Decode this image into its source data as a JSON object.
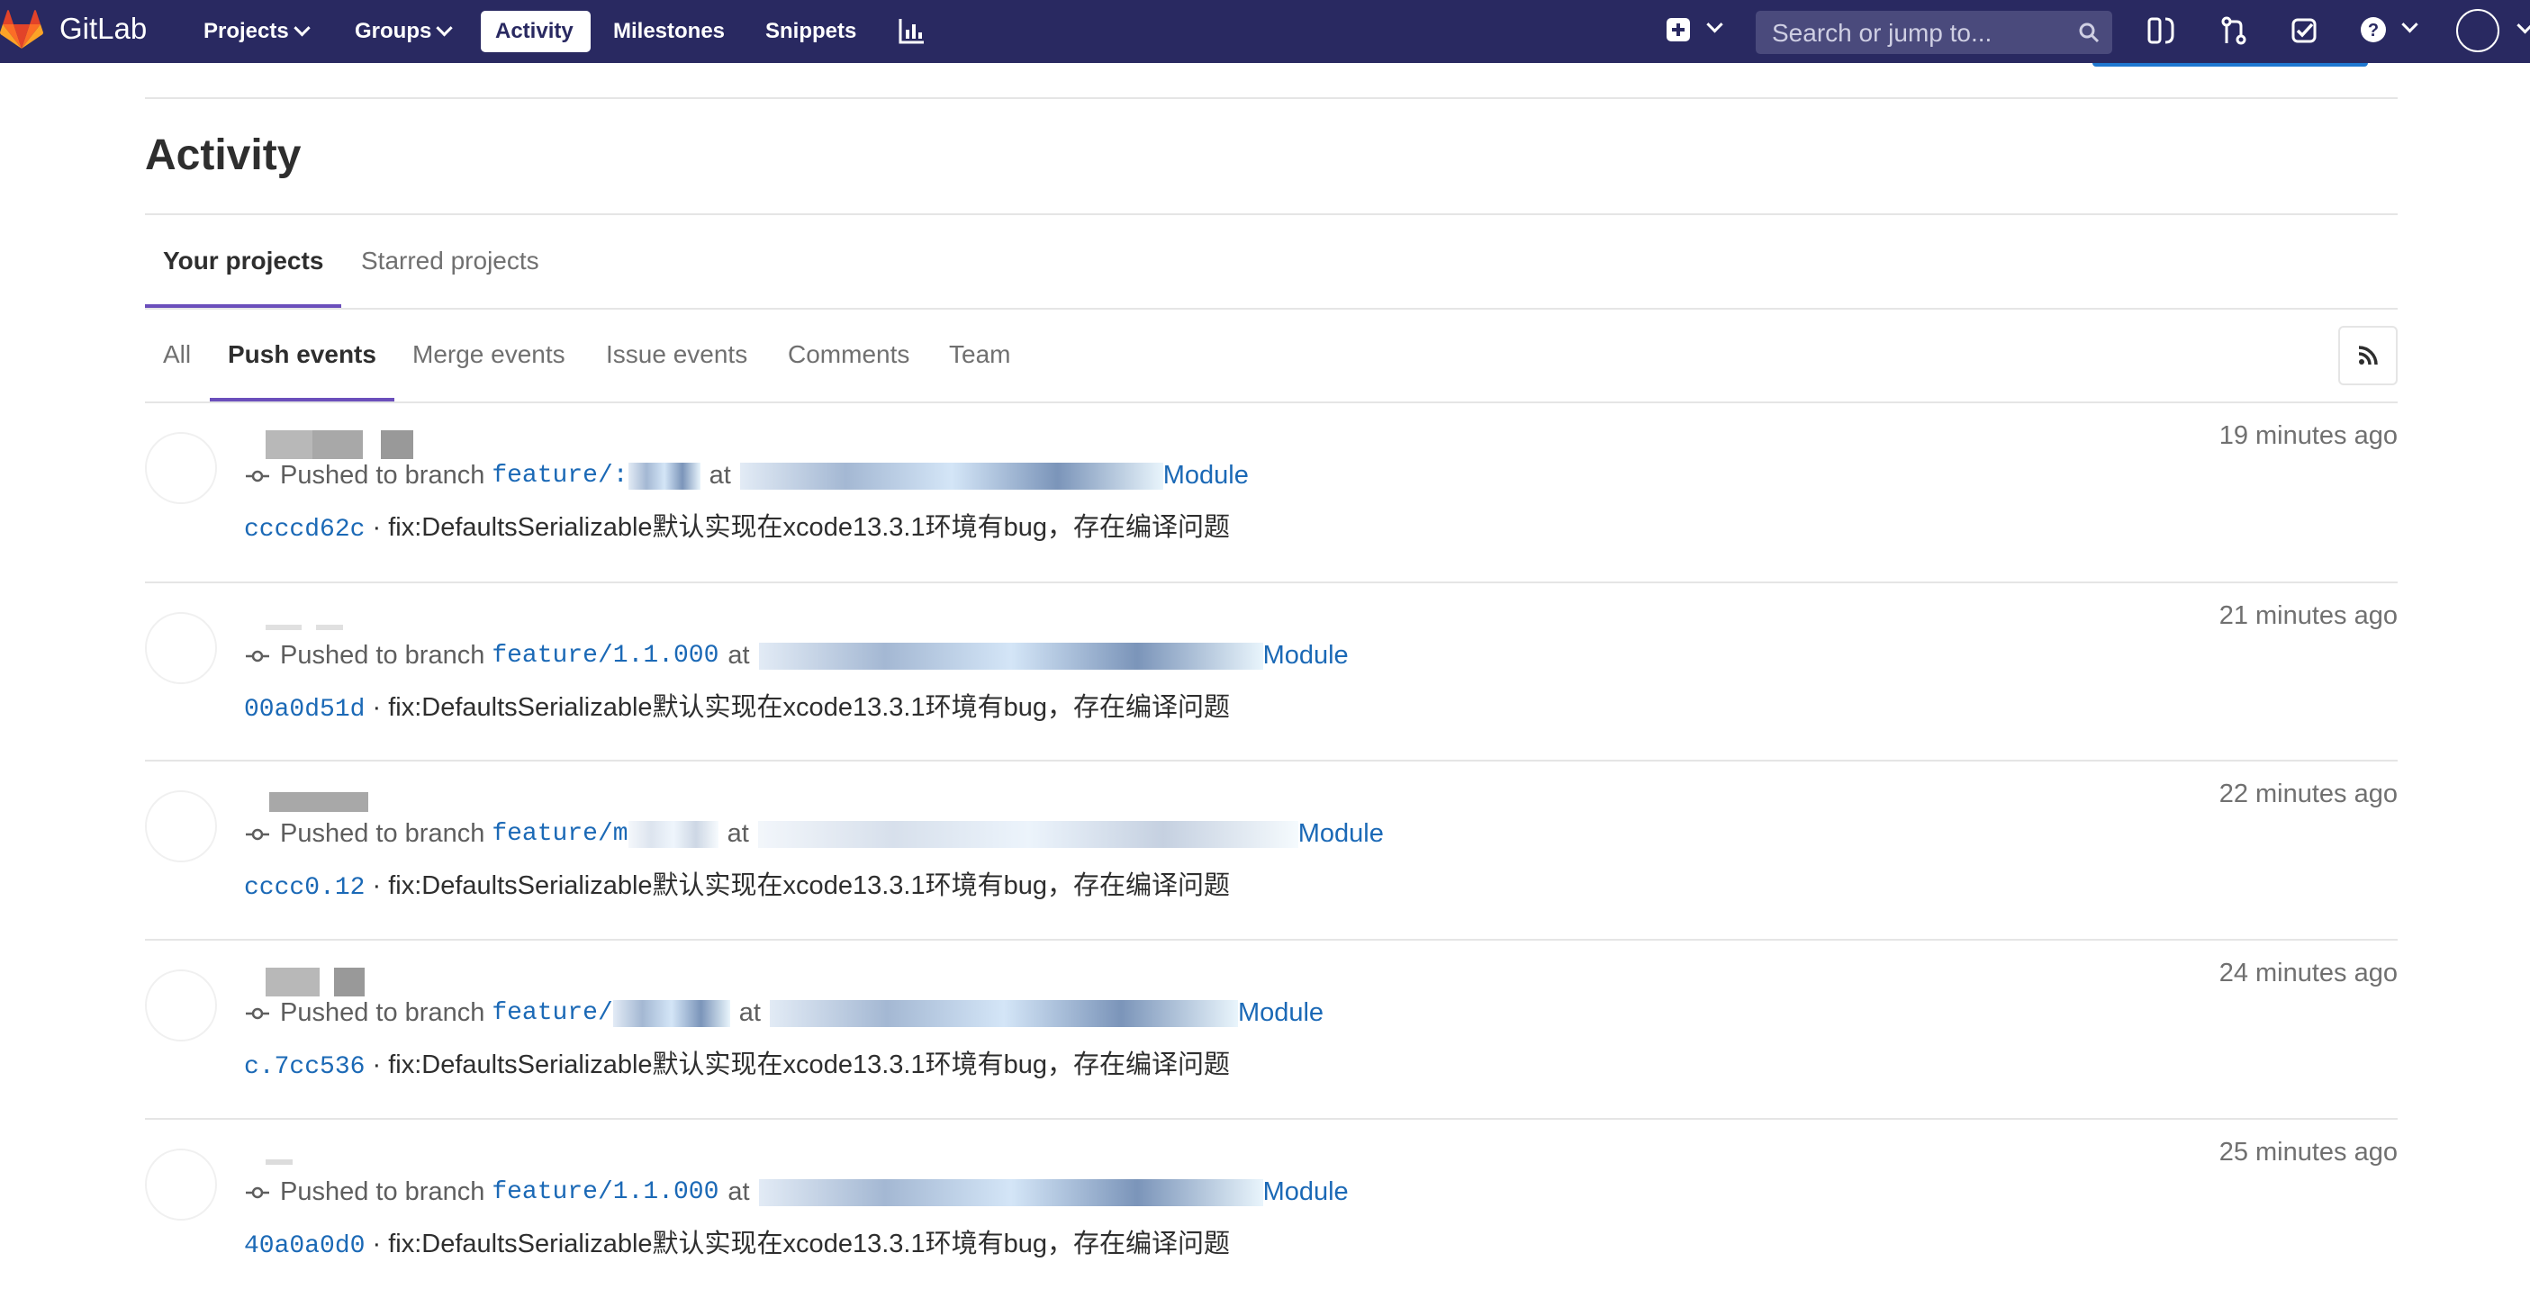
{
  "navbar": {
    "brand": "GitLab",
    "items": [
      {
        "label": "Projects",
        "dropdown": true
      },
      {
        "label": "Groups",
        "dropdown": true
      },
      {
        "label": "Activity",
        "active": true
      },
      {
        "label": "Milestones"
      },
      {
        "label": "Snippets"
      }
    ],
    "search_placeholder": "Search or jump to...",
    "icons": [
      "chart-icon",
      "plus-square-icon",
      "sidebar-toggle-icon",
      "merge-request-icon",
      "todo-check-icon",
      "help-icon",
      "avatar-icon"
    ]
  },
  "page": {
    "title": "Activity"
  },
  "project_tabs": [
    {
      "label": "Your projects",
      "active": true
    },
    {
      "label": "Starred projects",
      "active": false
    }
  ],
  "event_tabs": [
    {
      "label": "All",
      "active": false
    },
    {
      "label": "Push events",
      "active": true
    },
    {
      "label": "Merge events",
      "active": false
    },
    {
      "label": "Issue events",
      "active": false
    },
    {
      "label": "Comments",
      "active": false
    },
    {
      "label": "Team",
      "active": false
    }
  ],
  "events": [
    {
      "action": "Pushed to branch",
      "branch": "feature/:",
      "at": "at",
      "project": "Module",
      "sha": "ccccd62c",
      "message": "fix:DefaultsSerializable默认实现在xcode13.3.1环境有bug，存在编译问题",
      "time": "19 minutes ago"
    },
    {
      "action": "Pushed to branch",
      "branch": "feature/1.1.000",
      "at": "at",
      "project": "Module",
      "sha": "00a0d51d",
      "message": "fix:DefaultsSerializable默认实现在xcode13.3.1环境有bug，存在编译问题",
      "time": "21 minutes ago"
    },
    {
      "action": "Pushed to branch",
      "branch": "feature/m",
      "at": "at",
      "project": "Module",
      "sha": "cccc0.12",
      "message": "fix:DefaultsSerializable默认实现在xcode13.3.1环境有bug，存在编译问题",
      "time": "22 minutes ago"
    },
    {
      "action": "Pushed to branch",
      "branch": "feature/",
      "at": "at",
      "project": "Module",
      "sha": "c.7cc536",
      "message": "fix:DefaultsSerializable默认实现在xcode13.3.1环境有bug，存在编译问题",
      "time": "24 minutes ago"
    },
    {
      "action": "Pushed to branch",
      "branch": "feature/1.1.000",
      "at": "at",
      "project": "Module",
      "sha": "40a0a0d0",
      "message": "fix:DefaultsSerializable默认实现在xcode13.3.1环境有bug，存在编译问题",
      "time": "25 minutes ago"
    }
  ],
  "colors": {
    "navbar": "#292961",
    "tab_underline": "#6b4fbb",
    "link": "#1b69b6",
    "logo": "#e24329"
  }
}
